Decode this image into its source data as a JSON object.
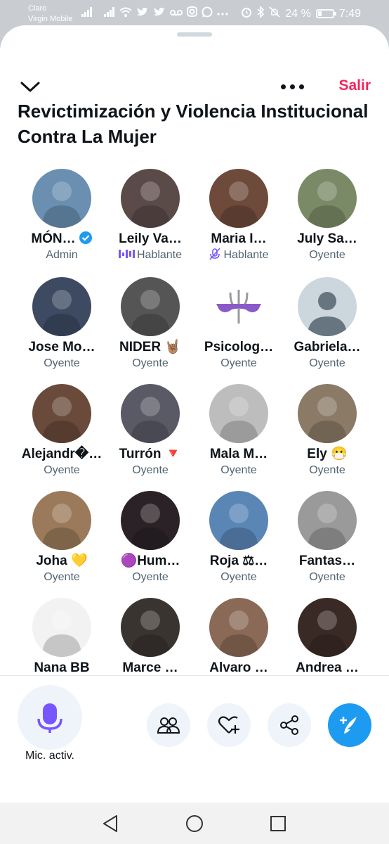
{
  "status_bar": {
    "carrier_line1": "Claro",
    "carrier_line2": "Virgin Mobile",
    "battery": "24 %",
    "time": "7:49",
    "icons": [
      "signal-icon",
      "signal-icon",
      "wifi-icon",
      "twitter-icon",
      "twitter-icon",
      "voicemail-icon",
      "instagram-icon",
      "whatsapp-icon",
      "more-icon",
      "alarm-icon",
      "bluetooth-icon",
      "mute-icon"
    ]
  },
  "header": {
    "leave_label": "Salir"
  },
  "space": {
    "title": "Revictimización y Violencia Institucional Contra La Mujer"
  },
  "participants": [
    {
      "name": "MÓN…",
      "role": "Admin",
      "verified": true,
      "color": "#6a8fb0"
    },
    {
      "name": "Leily Va…",
      "role": "Hablante",
      "badge": "speaking",
      "color": "#5a4a48"
    },
    {
      "name": "Maria I…",
      "role": "Hablante",
      "badge": "muted",
      "color": "#6d4a3a"
    },
    {
      "name": "July Sa…",
      "role": "Oyente",
      "color": "#7a8a66"
    },
    {
      "name": "Jose Mo…",
      "role": "Oyente",
      "color": "#3d4a62"
    },
    {
      "name": "NIDER 🤘🏽",
      "role": "Oyente",
      "color": "#555555"
    },
    {
      "name": "Psicolog…",
      "role": "Oyente",
      "color": "#ffffff"
    },
    {
      "name": "Gabriela…",
      "role": "Oyente",
      "color": "#ccd6dd"
    },
    {
      "name": "Alejandr�…",
      "role": "Oyente",
      "color": "#6a4a3a"
    },
    {
      "name": "Turrón 🔻",
      "role": "Oyente",
      "color": "#5a5a66"
    },
    {
      "name": "Mala M…",
      "role": "Oyente",
      "color": "#bdbdbd"
    },
    {
      "name": "Ely 😷",
      "role": "Oyente",
      "color": "#8a7a66"
    },
    {
      "name": "Joha 💛",
      "role": "Oyente",
      "color": "#9a7a5a"
    },
    {
      "name": "🟣Hum…",
      "role": "Oyente",
      "color": "#2a2226"
    },
    {
      "name": "Roja ⚖…",
      "role": "Oyente",
      "color": "#5a86b6"
    },
    {
      "name": "Fantas…",
      "role": "Oyente",
      "color": "#9a9a9a"
    },
    {
      "name": "Nana BB",
      "role": "",
      "color": "#f2f2f2"
    },
    {
      "name": "Marce …",
      "role": "",
      "color": "#3a3430"
    },
    {
      "name": "Alvaro …",
      "role": "",
      "color": "#8a6a56"
    },
    {
      "name": "Andrea …",
      "role": "",
      "color": "#3a2a26"
    }
  ],
  "toolbar": {
    "mic_label": "Mic. activ."
  },
  "colors": {
    "accent_leave": "#f4245e",
    "accent_purple": "#7856ff",
    "tweet_blue": "#1d9bf0"
  }
}
